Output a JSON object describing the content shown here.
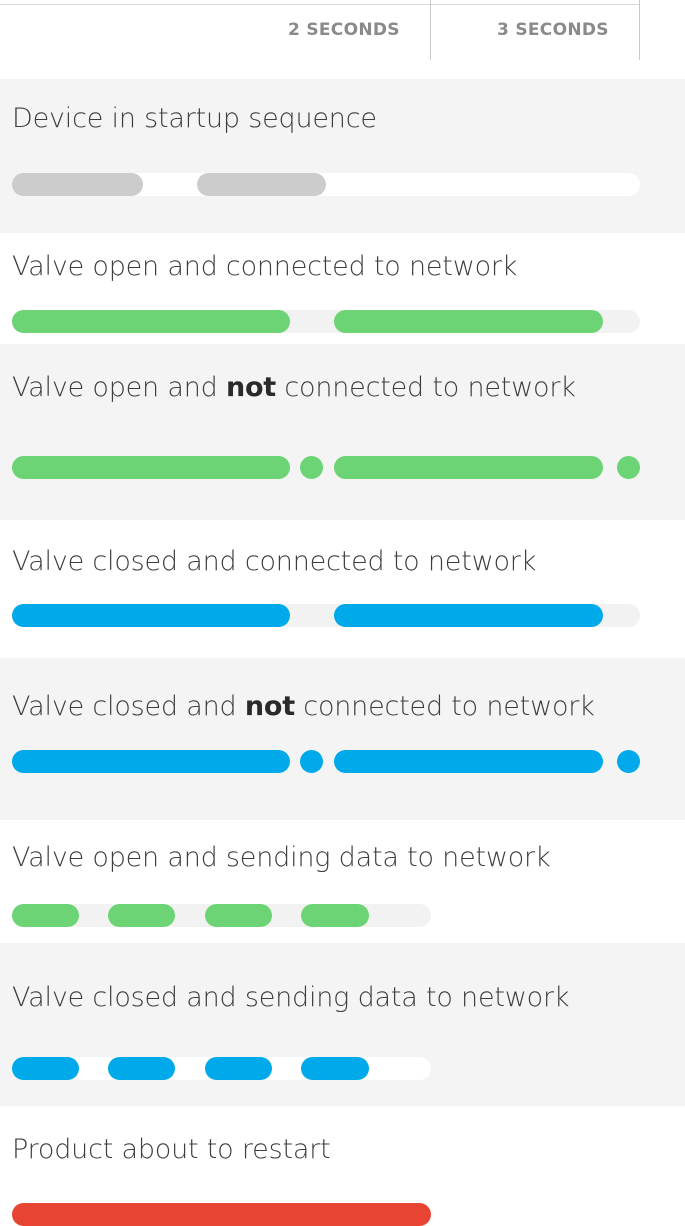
{
  "header": {
    "time_2": "2 SECONDS",
    "time_3": "3 SECONDS"
  },
  "colors": {
    "gray": "#cccccc",
    "green": "#6cd474",
    "blue": "#00aaea",
    "red": "#e84434"
  },
  "rows": [
    {
      "label_pre": "Device in startup sequence",
      "label_bold": "",
      "label_post": "",
      "pattern": "gray long blinks"
    },
    {
      "label_pre": "Valve open and connected to network",
      "label_bold": "",
      "label_post": "",
      "pattern": "green long blinks"
    },
    {
      "label_pre": "Valve open and ",
      "label_bold": "not",
      "label_post": " connected to network",
      "pattern": "green long + short blinks"
    },
    {
      "label_pre": "Valve closed and connected to network",
      "label_bold": "",
      "label_post": "",
      "pattern": "blue long blinks"
    },
    {
      "label_pre": "Valve closed and ",
      "label_bold": "not",
      "label_post": " connected to network",
      "pattern": "blue long + short blinks"
    },
    {
      "label_pre": "Valve open and sending data to network",
      "label_bold": "",
      "label_post": "",
      "pattern": "green fast blinks"
    },
    {
      "label_pre": "Valve closed and sending data to network",
      "label_bold": "",
      "label_post": "",
      "pattern": "blue fast blinks"
    },
    {
      "label_pre": "Product about to restart",
      "label_bold": "",
      "label_post": "",
      "pattern": "red solid"
    }
  ]
}
